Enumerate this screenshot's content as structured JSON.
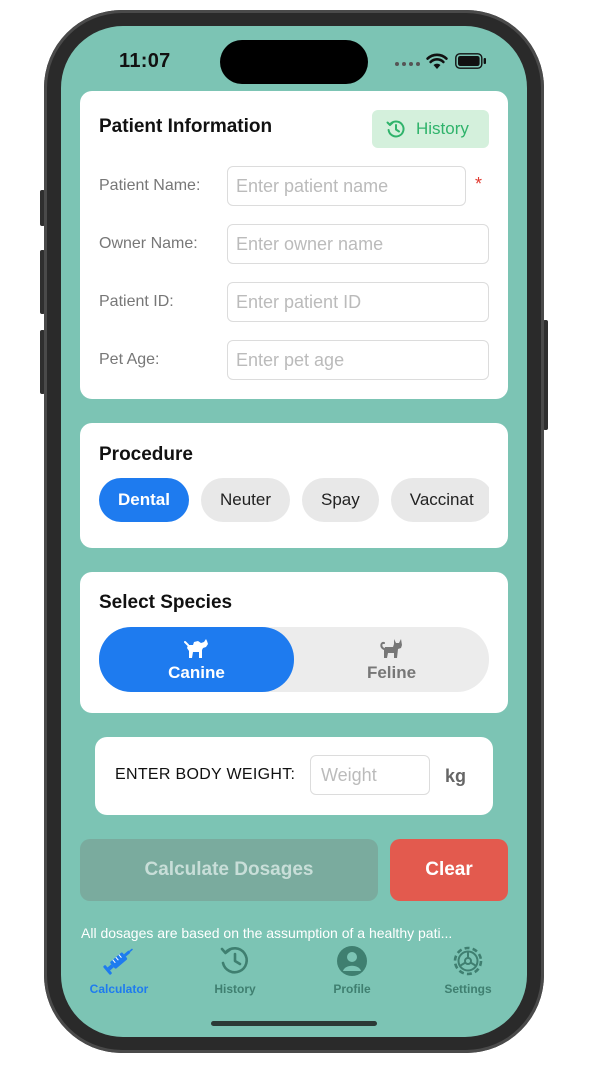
{
  "status_bar": {
    "time": "11:07"
  },
  "patient_info": {
    "title": "Patient Information",
    "history_label": "History",
    "fields": [
      {
        "label": "Patient Name:",
        "placeholder": "Enter patient name",
        "required_mark": "*"
      },
      {
        "label": "Owner Name:",
        "placeholder": "Enter owner name"
      },
      {
        "label": "Patient ID:",
        "placeholder": "Enter patient ID"
      },
      {
        "label": "Pet Age:",
        "placeholder": "Enter pet age"
      }
    ]
  },
  "procedure": {
    "title": "Procedure",
    "options": [
      "Dental",
      "Neuter",
      "Spay",
      "Vaccinat"
    ],
    "selected": "Dental"
  },
  "species": {
    "title": "Select Species",
    "options": [
      {
        "label": "Canine",
        "icon": "dog-icon"
      },
      {
        "label": "Feline",
        "icon": "cat-icon"
      }
    ],
    "selected": "Canine"
  },
  "weight": {
    "label": "ENTER BODY WEIGHT:",
    "placeholder": "Weight",
    "unit": "kg"
  },
  "actions": {
    "calculate_label": "Calculate Dosages",
    "clear_label": "Clear"
  },
  "disclaimer": "All dosages are based on the assumption of a healthy pati...",
  "tab_bar": {
    "items": [
      {
        "label": "Calculator",
        "icon": "syringe-icon",
        "active": true
      },
      {
        "label": "History",
        "icon": "history-icon",
        "active": false
      },
      {
        "label": "Profile",
        "icon": "profile-icon",
        "active": false
      },
      {
        "label": "Settings",
        "icon": "gear-icon",
        "active": false
      }
    ]
  },
  "colors": {
    "background": "#7cc4b4",
    "accent": "#1e7bef",
    "history_green": "#2fb36b",
    "clear_red": "#e35a4e",
    "calculate_disabled": "#7aab9e"
  }
}
